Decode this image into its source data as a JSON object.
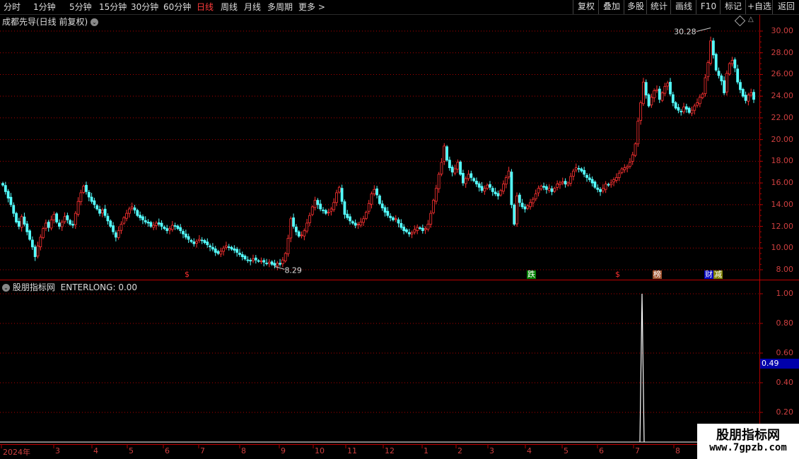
{
  "toolbar": {
    "periods": [
      "分时",
      "1分钟",
      "5分钟",
      "15分钟",
      "30分钟",
      "60分钟",
      "日线",
      "周线",
      "月线",
      "多周期",
      "更多 >"
    ],
    "active_period": "日线",
    "right_buttons": [
      "复权",
      "叠加",
      "多股",
      "统计",
      "画线",
      "F10",
      "标记",
      "+自选",
      "返回"
    ]
  },
  "main_panel": {
    "title": "成都先导(日线 前复权)",
    "title_icon": "chevron-down-icon",
    "corner_icon": "diamond-icon",
    "y_ticks": [
      "30.00",
      "28.00",
      "26.00",
      "24.00",
      "22.00",
      "20.00",
      "18.00",
      "16.00",
      "14.00",
      "12.00",
      "10.00",
      "8.00"
    ],
    "high_label": "30.28",
    "low_label": "8.29",
    "signals": [
      {
        "text": "$",
        "color": "#ff3030",
        "bg": "#000000"
      },
      {
        "text": "跌",
        "color": "#ffffff",
        "bg": "#008000"
      },
      {
        "text": "$",
        "color": "#ff3030",
        "bg": "#000000"
      },
      {
        "text": "榜",
        "color": "#ffffff",
        "bg": "#a0522d"
      },
      {
        "text": "财",
        "color": "#ffffff",
        "bg": "#0000c0"
      },
      {
        "text": "减",
        "color": "#ffffff",
        "bg": "#808000"
      }
    ]
  },
  "sub_panel": {
    "title": "股朋指标网",
    "indicator_label": "ENTERLONG: 0.00",
    "y_ticks": [
      "1.00",
      "0.80",
      "0.60",
      "0.40",
      "0.20"
    ],
    "current_value": "0.49"
  },
  "x_axis": {
    "labels": [
      "2024年",
      "3",
      "4",
      "5",
      "6",
      "7",
      "8",
      "9",
      "10",
      "11",
      "12",
      "1",
      "2",
      "3",
      "4",
      "5",
      "6",
      "7",
      "8"
    ]
  },
  "watermark": {
    "line1": "股朋指标网",
    "line2": "www.7gpzb.com"
  },
  "colors": {
    "up": "#ff3232",
    "down": "#54ffff",
    "grid": "#b00000",
    "axis_text": "#d04040"
  },
  "chart_data": {
    "type": "candlestick",
    "price_range": [
      8.0,
      30.5
    ],
    "closes": [
      15.8,
      15.2,
      14.6,
      14.0,
      13.2,
      12.4,
      12.0,
      12.9,
      12.2,
      11.5,
      10.8,
      10.1,
      9.2,
      10.2,
      11.0,
      11.8,
      12.3,
      11.9,
      12.6,
      13.1,
      12.4,
      12.0,
      12.4,
      12.9,
      12.6,
      12.2,
      12.1,
      13.2,
      14.3,
      15.1,
      15.7,
      15.2,
      14.7,
      14.3,
      14.0,
      13.6,
      13.2,
      13.5,
      13.0,
      12.5,
      12.0,
      11.5,
      11.0,
      11.6,
      12.2,
      12.8,
      13.2,
      13.6,
      13.8,
      13.5,
      13.0,
      12.8,
      12.6,
      12.4,
      12.3,
      12.0,
      12.1,
      12.3,
      12.2,
      12.0,
      11.8,
      11.6,
      11.8,
      12.1,
      12.0,
      11.8,
      11.6,
      11.3,
      11.0,
      10.8,
      10.6,
      10.4,
      10.6,
      10.8,
      10.7,
      10.5,
      10.3,
      10.1,
      9.9,
      9.6,
      9.5,
      9.7,
      10.0,
      10.2,
      10.1,
      9.9,
      9.8,
      9.6,
      9.4,
      9.2,
      9.0,
      8.9,
      8.8,
      9.0,
      8.9,
      8.8,
      8.8,
      8.7,
      8.6,
      8.7,
      8.5,
      8.4,
      8.6,
      8.5,
      8.9,
      9.5,
      10.9,
      12.7,
      12.0,
      11.5,
      11.1,
      11.2,
      11.6,
      12.3,
      13.0,
      13.8,
      14.4,
      14.0,
      13.6,
      13.5,
      13.2,
      13.3,
      13.6,
      14.2,
      15.1,
      15.6,
      14.3,
      13.1,
      12.8,
      12.5,
      12.3,
      12.1,
      12.2,
      12.4,
      12.7,
      13.3,
      14.1,
      15.0,
      15.4,
      14.9,
      14.1,
      13.7,
      13.3,
      13.0,
      12.8,
      12.6,
      12.7,
      12.3,
      11.9,
      11.6,
      11.5,
      11.3,
      11.4,
      11.7,
      11.9,
      11.8,
      11.6,
      11.8,
      12.2,
      13.2,
      14.4,
      15.5,
      16.8,
      17.9,
      19.4,
      18.1,
      17.4,
      17.0,
      17.3,
      17.9,
      16.8,
      16.0,
      16.4,
      16.8,
      16.5,
      16.2,
      15.9,
      15.6,
      15.3,
      15.5,
      15.8,
      15.6,
      15.2,
      15.0,
      14.8,
      15.3,
      15.9,
      16.5,
      17.1,
      14.0,
      12.2,
      14.8,
      14.2,
      13.8,
      13.6,
      13.9,
      14.2,
      14.5,
      15.0,
      15.5,
      15.7,
      15.6,
      15.4,
      15.5,
      15.2,
      15.5,
      15.9,
      16.0,
      16.1,
      15.9,
      16.0,
      16.6,
      17.1,
      17.4,
      17.3,
      17.1,
      16.8,
      16.5,
      16.3,
      16.0,
      15.6,
      15.4,
      15.2,
      15.5,
      15.9,
      15.8,
      16.0,
      16.3,
      16.5,
      16.9,
      17.3,
      17.4,
      17.5,
      17.9,
      18.6,
      19.6,
      21.7,
      23.4,
      25.3,
      24.1,
      23.1,
      23.9,
      24.5,
      24.6,
      23.7,
      24.3,
      24.9,
      25.2,
      24.2,
      23.4,
      22.9,
      22.7,
      22.6,
      23.0,
      22.8,
      22.5,
      22.7,
      23.1,
      23.4,
      23.9,
      24.2,
      25.7,
      27.1,
      29.1,
      27.8,
      26.4,
      25.9,
      25.4,
      24.3,
      26.1,
      27.0,
      27.3,
      26.6,
      25.3,
      24.6,
      24.0,
      23.6,
      24.1,
      24.3,
      23.7
    ],
    "enterlong_signals": [
      {
        "index": 0,
        "value": 1.0
      }
    ],
    "enterlong_range": [
      0,
      1.05
    ]
  }
}
